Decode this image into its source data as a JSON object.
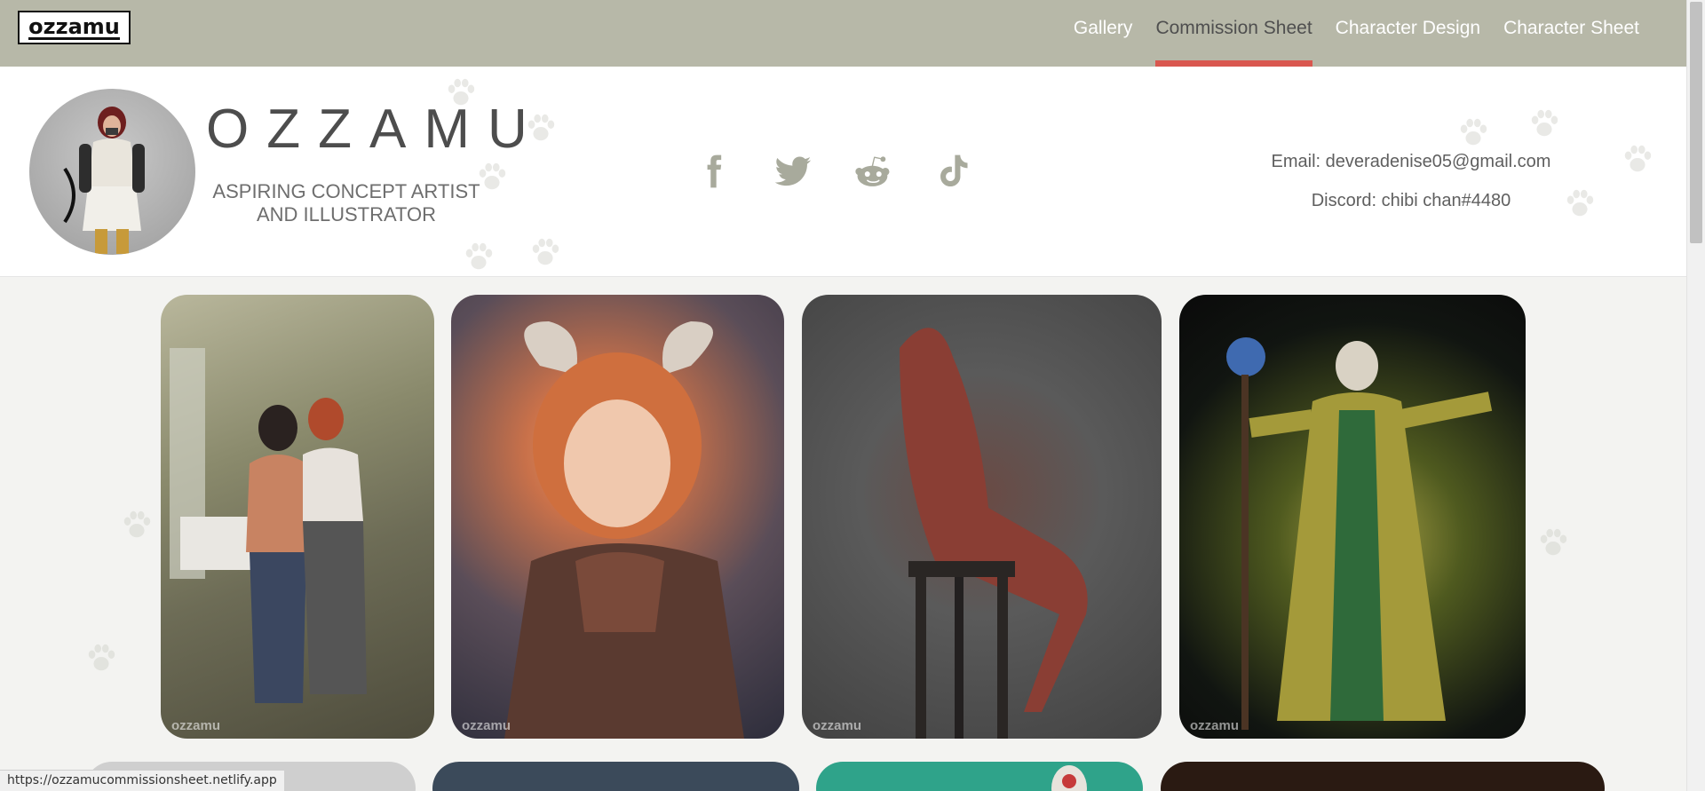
{
  "nav": {
    "logo_text": "ozzamu",
    "items": [
      {
        "label": "Gallery",
        "active": false
      },
      {
        "label": "Commission Sheet",
        "active": true
      },
      {
        "label": "Character Design",
        "active": false
      },
      {
        "label": "Character Sheet",
        "active": false
      }
    ]
  },
  "header": {
    "brand_name": "OZZAMU",
    "tagline_line1": "ASPIRING CONCEPT ARTIST",
    "tagline_line2": "AND ILLUSTRATOR",
    "socials": [
      "facebook-icon",
      "twitter-icon",
      "reddit-icon",
      "tiktok-icon"
    ],
    "email_label": "Email: deveradenise05@gmail.com",
    "discord_label": "Discord: chibi chan#4480"
  },
  "gallery": {
    "watermark": "ozzamu"
  },
  "status_bar": {
    "url": "https://ozzamucommissionsheet.netlify.app"
  },
  "colors": {
    "nav_bg": "#b7b8a8",
    "active_underline": "#d9574f",
    "page_bg": "#f3f3f1"
  }
}
